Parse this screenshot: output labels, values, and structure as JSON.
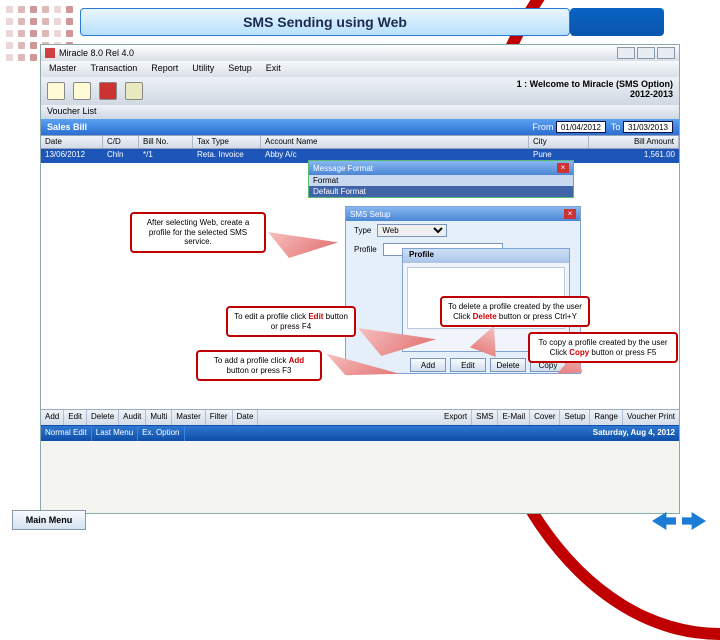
{
  "slide": {
    "title": "SMS Sending using Web"
  },
  "app": {
    "window_title": "Miracle 8.0 Rel 4.0",
    "welcome_line1": "1 : Welcome to Miracle (SMS Option)",
    "welcome_line2": "2012-2013",
    "menu": [
      "Master",
      "Transaction",
      "Report",
      "Utility",
      "Setup",
      "Exit"
    ],
    "voucher_tab": "Voucher List",
    "sales_bar": {
      "title": "Sales Bill",
      "from_lbl": "From",
      "from_val": "01/04/2012",
      "to_lbl": "To",
      "to_val": "31/03/2013"
    },
    "grid": {
      "cols": [
        "Date",
        "C/D",
        "Bill No.",
        "Tax Type",
        "Account Name",
        "City",
        "Bill Amount"
      ],
      "row": {
        "date": "13/06/2012",
        "cd": "Chln",
        "bill": "*/1",
        "tax": "Reta. Invoice",
        "acc": "Abby A/c",
        "city": "Pune",
        "amt": "1,561.00"
      }
    },
    "popup1": {
      "title": "Message Format",
      "format_lbl": "Format",
      "format_val": "Default Format"
    },
    "popup2": {
      "title": "SMS Setup",
      "type_lbl": "Type",
      "type_val": "Web",
      "profile_lbl": "Profile",
      "profile_popup_title": "Profile",
      "buttons": [
        "Add",
        "Edit",
        "Delete",
        "Copy"
      ]
    },
    "bottom_bar1": [
      "Add",
      "Edit",
      "Delete",
      "Audit",
      "Multi",
      "Master",
      "Filter",
      "Date",
      "Export",
      "SMS",
      "E-Mail",
      "Cover",
      "Setup",
      "Range",
      "Voucher Print"
    ],
    "status_bar": {
      "left": [
        "Normal Edit",
        "Last Menu",
        "Ex. Option"
      ],
      "right": "Saturday, Aug 4, 2012"
    }
  },
  "callouts": {
    "c1": "After selecting Web, create a profile for the selected SMS service.",
    "c2_pre": "To edit a profile click ",
    "c2_btn": "Edit",
    "c2_post": " button or press F4",
    "c3_pre": "To add a profile click ",
    "c3_btn": "Add",
    "c3_post": " button or press F3",
    "c4_pre": "To delete a profile created by the user Click ",
    "c4_btn": "Delete",
    "c4_post": " button or press Ctrl+Y",
    "c5_pre": "To copy a profile created by the user Click ",
    "c5_btn": "Copy",
    "c5_post": " button or press F5"
  },
  "footer": {
    "main_menu": "Main Menu"
  }
}
